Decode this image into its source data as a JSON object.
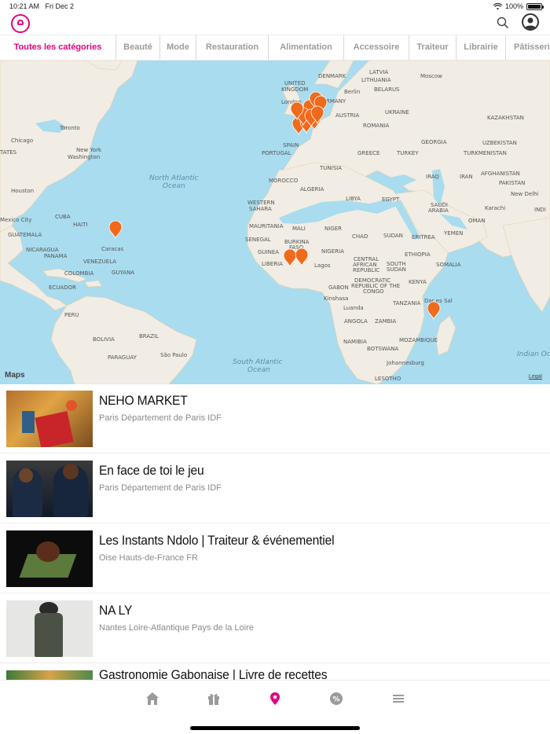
{
  "status": {
    "time": "10:21 AM",
    "date": "Fri Dec 2",
    "battery": "100%",
    "battery_level": 1.0
  },
  "colors": {
    "accent": "#e6007e",
    "pin": "#f06a1b"
  },
  "icons": {
    "search": "search-icon",
    "profile": "user-icon",
    "logo": "app-logo-icon"
  },
  "tabs": [
    {
      "label": "Toutes les catégories",
      "active": true
    },
    {
      "label": "Beauté"
    },
    {
      "label": "Mode"
    },
    {
      "label": "Restauration"
    },
    {
      "label": "Alimentation"
    },
    {
      "label": "Accessoire"
    },
    {
      "label": "Traiteur"
    },
    {
      "label": "Librairie"
    },
    {
      "label": "Pâtisseri"
    }
  ],
  "map": {
    "credit": "Maps",
    "legal": "Legal",
    "labels": {
      "north_atlantic": "North Atlantic",
      "ocean1": "Ocean",
      "south_atlantic": "South Atlantic",
      "ocean2": "Ocean",
      "indian": "Indian Oc",
      "united": "UNITED",
      "kingdom": "KINGDOM",
      "denmark": "DENMARK",
      "latvia": "LATVIA",
      "lithuania": "LITHUANIA",
      "belarus": "BELARUS",
      "moscow": "Moscow",
      "london": "London",
      "berlin": "Berlin",
      "germany": "RMANY",
      "austria": "AUSTRIA",
      "ukraine": "UKRAINE",
      "romania": "ROMANIA",
      "kazakhstan": "KAZAKHSTAN",
      "uzbekistan": "UZBEKISTAN",
      "turkmenistan": "TURKMENISTAN",
      "georgia": "GEORGIA",
      "portugal": "PORTUGAL",
      "spain": "SPAIN",
      "greece": "GREECE",
      "turkey": "TURKEY",
      "tunisia": "TUNISIA",
      "morocco": "MOROCCO",
      "algeria": "ALGERIA",
      "libya": "LIBYA",
      "egypt": "EGYPT",
      "iraq": "IRAQ",
      "iran": "IRAN",
      "afghanistan": "AFGHANISTAN",
      "pakistan": "PAKISTAN",
      "new_delhi": "New Delhi",
      "karachi": "Karachi",
      "india": "INDI",
      "saudi": "SAUDI",
      "arabia": "ARABIA",
      "oman": "OMAN",
      "yemen": "YEMEN",
      "western": "WESTERN",
      "sahara": "SAHARA",
      "mauritania": "MAURITANIA",
      "mali": "MALI",
      "niger": "NIGER",
      "chad": "CHAD",
      "sudan": "SUDAN",
      "eritrea": "ERITREA",
      "senegal": "SENEGAL",
      "burkina": "BURKINA",
      "faso": "FASO",
      "guinea": "GUINEA",
      "liberia": "LIBERIA",
      "nigeria": "NIGERIA",
      "lagos": "Lagos",
      "ethiopia": "ETHIOPIA",
      "central": "CENTRAL",
      "african": "AFRICAN",
      "republic": "REPUBLIC",
      "south": "SOUTH",
      "sudan2": "SUDAN",
      "somalia": "SOMALIA",
      "kenya": "KENYA",
      "gabon": "GABON",
      "democratic": "DEMOCRATIC",
      "republic2": "REPUBLIC OF THE",
      "congo": "CONGO",
      "kinshasa": "Kinshasa",
      "tanzania": "TANZANIA",
      "luanda": "Luanda",
      "angola": "ANGOLA",
      "zambia": "ZAMBIA",
      "mozambique": "MOZAMBIQUE",
      "namibia": "NAMIBIA",
      "botswana": "BOTSWANA",
      "johannesburg": "Johannesburg",
      "lesotho": "LESOTHO",
      "chicago": "Chicago",
      "toronto": "Toronto",
      "new_york": "New York",
      "washington": "Washington",
      "states": "TATES",
      "houston": "Houston",
      "mexico_city": "Mexico City",
      "cuba": "CUBA",
      "haiti": "HAITI",
      "guatemala": "GUATEMALA",
      "nicaragua": "NICARAGUA",
      "panama": "PANAMA",
      "caracas": "Caracas",
      "venezuela": "VENEZUELA",
      "guyana": "GUYANA",
      "colombia": "COLOMBIA",
      "ecuador": "ECUADOR",
      "peru": "PERU",
      "bolivia": "BOLIVIA",
      "brazil": "BRAZIL",
      "paraguay": "PARAGUAY",
      "sao_paulo": "São Paulo",
      "dar": "Dar es Sal"
    }
  },
  "listings": [
    {
      "title": "NEHO MARKET",
      "location": "Paris Département de Paris IDF"
    },
    {
      "title": "En face de toi le jeu",
      "location": "Paris Département de Paris IDF"
    },
    {
      "title": "Les Instants Ndolo | Traiteur & événementiel",
      "location": "Oise Hauts-de-France FR"
    },
    {
      "title": "NA LY",
      "location": "Nantes Loire-Atlantique Pays de la Loire"
    },
    {
      "title": "Gastronomie Gabonaise | Livre de recettes",
      "location": ""
    }
  ],
  "bottom_nav": [
    {
      "name": "home-icon",
      "active": false
    },
    {
      "name": "gift-icon",
      "active": false
    },
    {
      "name": "map-pin-icon",
      "active": true
    },
    {
      "name": "discount-icon",
      "active": false
    },
    {
      "name": "menu-icon",
      "active": false
    }
  ]
}
